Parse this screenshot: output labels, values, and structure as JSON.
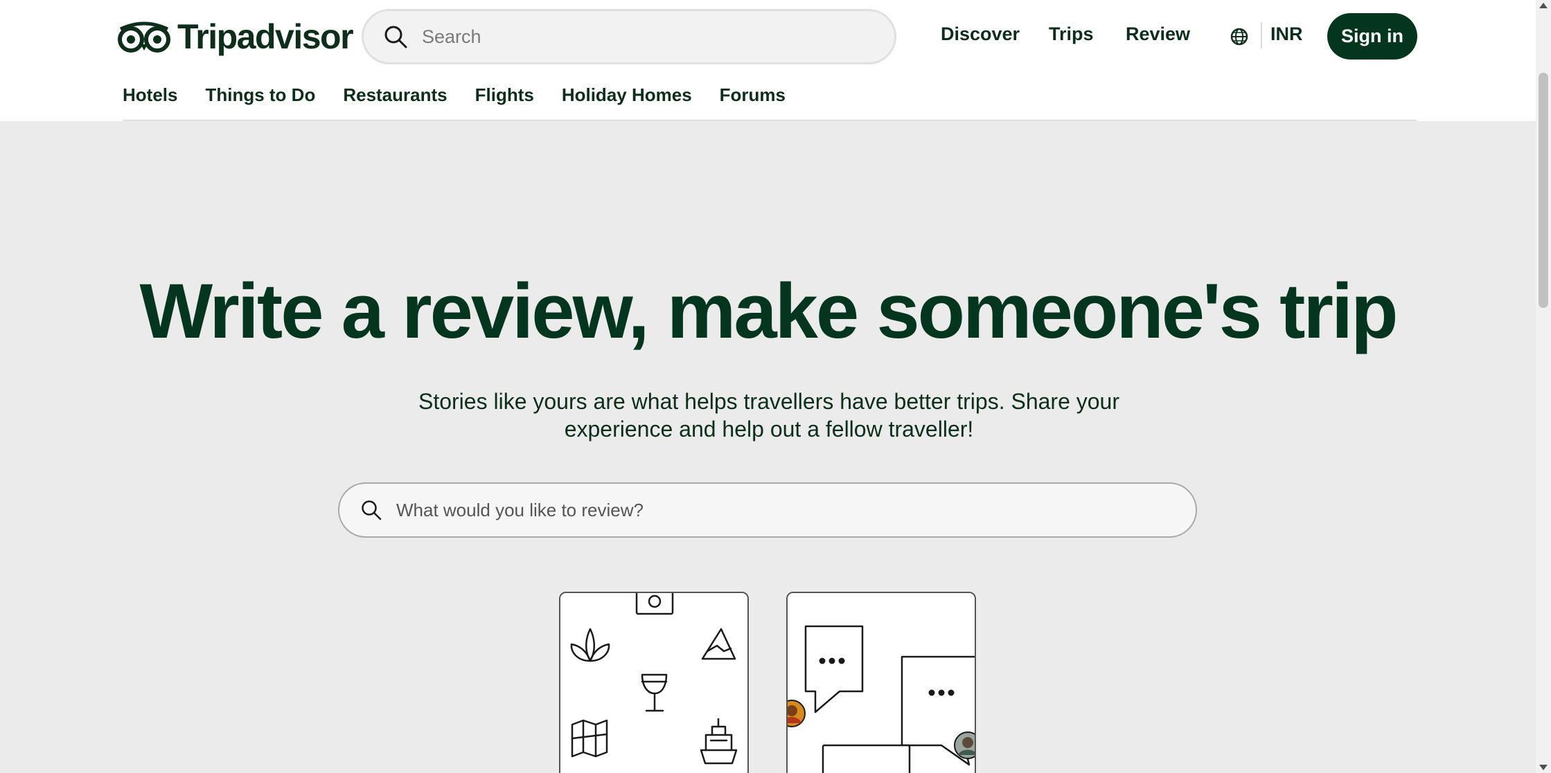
{
  "brand": {
    "logo_text": "Tripadvisor",
    "logo_icon": "owl-eyes-icon",
    "primary_color": "#04361f"
  },
  "header": {
    "search_placeholder": "Search",
    "nav": {
      "discover": "Discover",
      "trips": "Trips",
      "review": "Review"
    },
    "language_icon": "globe-icon",
    "currency": "INR",
    "sign_in": "Sign in"
  },
  "subnav": {
    "items": [
      "Hotels",
      "Things to Do",
      "Restaurants",
      "Flights",
      "Holiday Homes",
      "Forums"
    ]
  },
  "hero": {
    "title": "Write a review, make someone's trip",
    "subtitle": "Stories like yours are what helps travellers have better trips. Share your experience and help out a fellow traveller!",
    "search_placeholder": "What would you like to review?"
  },
  "cards": [
    {
      "illustration": "travel-icons-illustration"
    },
    {
      "illustration": "chat-bubbles-illustration"
    }
  ],
  "background_color": "#ebebeb"
}
